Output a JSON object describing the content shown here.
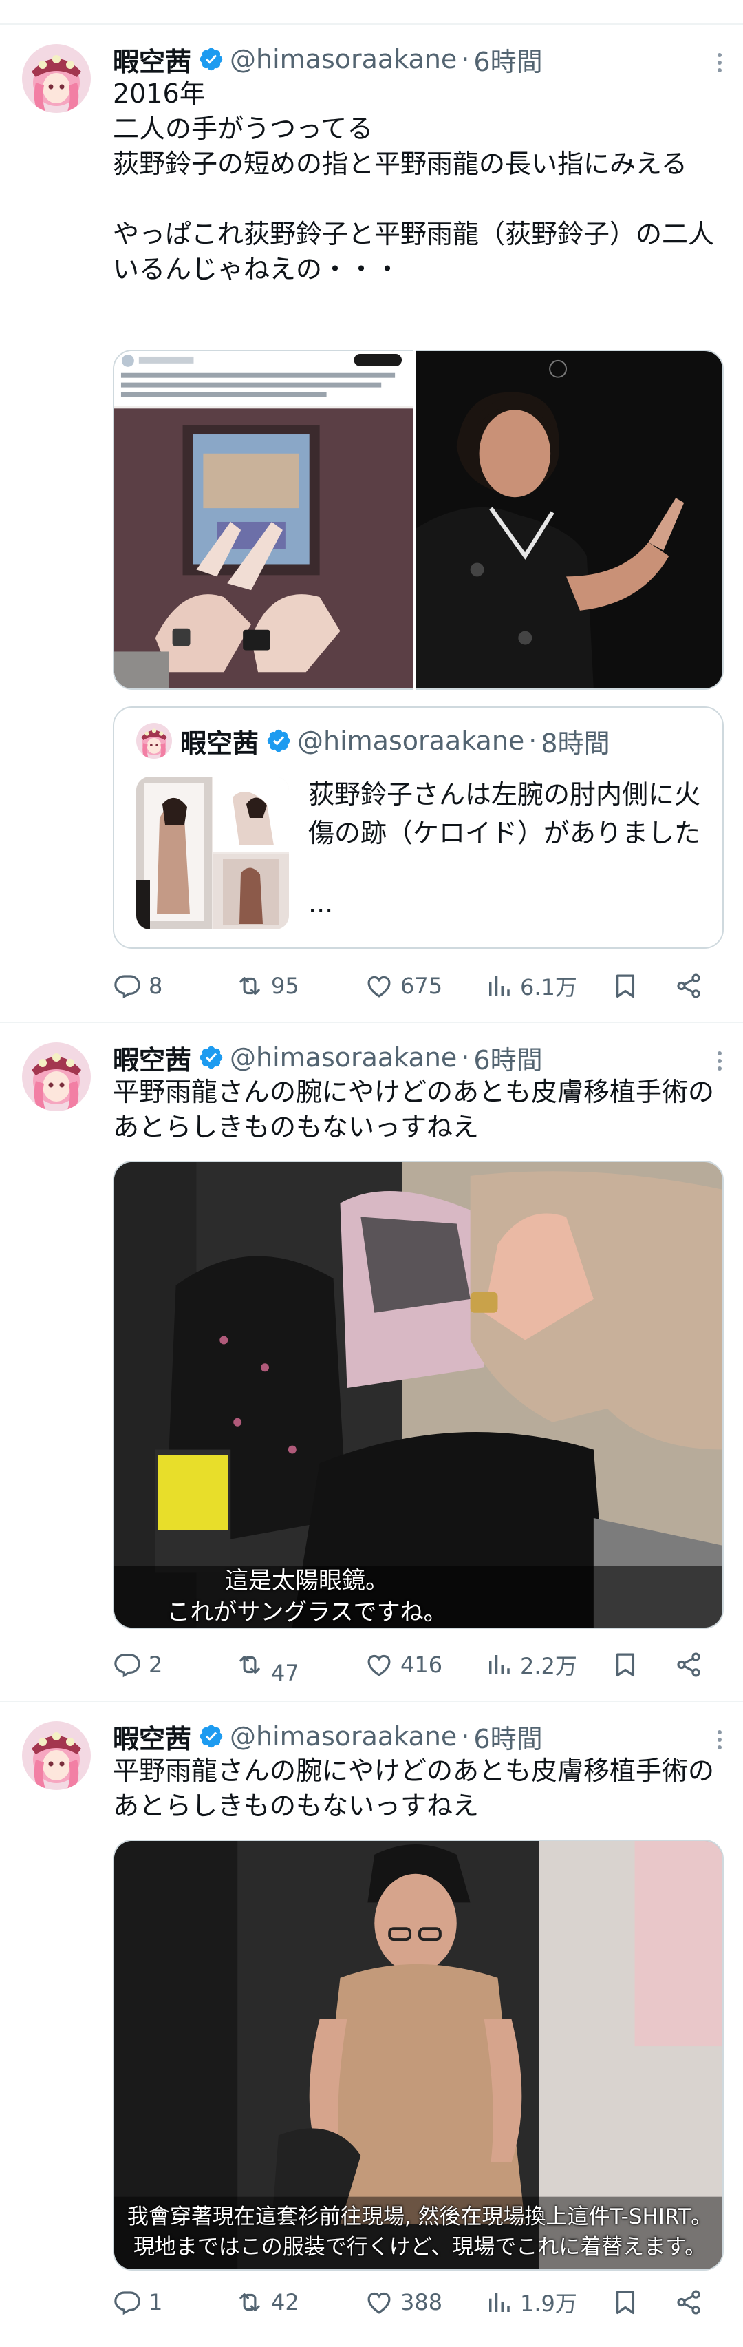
{
  "colors": {
    "accent": "#1d9bf0",
    "text": "#0f1419",
    "muted": "#536471",
    "border": "#eff3f4"
  },
  "tweets": [
    {
      "author": {
        "name": "暇空茜",
        "handle": "@himasoraakane",
        "verified": true
      },
      "time": "6時間",
      "text": "2016年\n二人の手がうつってる\n荻野鈴子の短めの指と平野雨龍の長い指にみえる\n\nやっぱこれ荻野鈴子と平野雨龍（荻野鈴子）の二人いるんじゃねえの・・・",
      "media": [
        "photo-two-hands-peace-sign",
        "photo-woman-in-kimono-gesturing"
      ],
      "quote": {
        "author": {
          "name": "暇空茜",
          "handle": "@himasoraakane",
          "verified": true
        },
        "time": "8時間",
        "text": "荻野鈴子さんは左腕の肘内側に火傷の跡（ケロイド）がありました",
        "ellipsis": "..."
      },
      "stats": {
        "replies": "8",
        "retweets": "95",
        "likes": "675",
        "views": "6.1万"
      }
    },
    {
      "author": {
        "name": "暇空茜",
        "handle": "@himasoraakane",
        "verified": true
      },
      "time": "6時間",
      "text": "平野雨龍さんの腕にやけどのあとも皮膚移植手術のあとらしきものもないっすねえ",
      "video": {
        "subtitle_line1": "這是太陽眼鏡。",
        "subtitle_line2": "これがサングラスですね。"
      },
      "stats": {
        "replies": "2",
        "retweets": "47",
        "likes": "416",
        "views": "2.2万"
      }
    },
    {
      "author": {
        "name": "暇空茜",
        "handle": "@himasoraakane",
        "verified": true
      },
      "time": "6時間",
      "text": "平野雨龍さんの腕にやけどのあとも皮膚移植手術のあとらしきものもないっすねえ",
      "video": {
        "subtitle_line1": "我會穿著現在這套衫前往現場, 然後在現場換上這件T-SHIRT。",
        "subtitle_line2": "現地まではこの服装で行くけど、現場でこれに着替えます。"
      },
      "stats": {
        "replies": "1",
        "retweets": "42",
        "likes": "388",
        "views": "1.9万"
      }
    }
  ]
}
